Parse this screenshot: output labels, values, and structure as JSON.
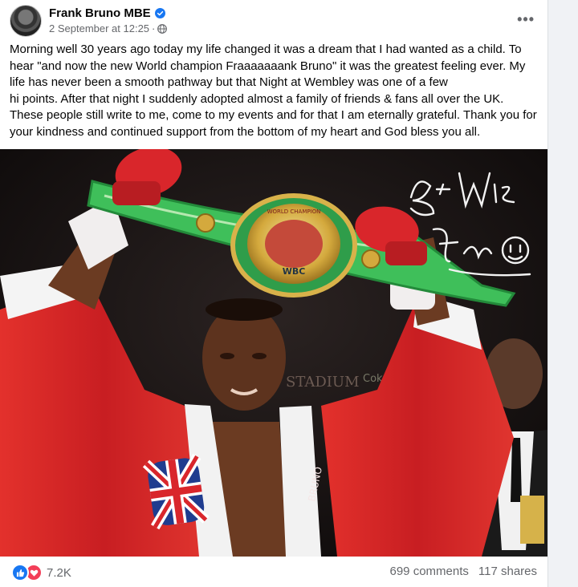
{
  "post": {
    "author": "Frank Bruno MBE",
    "timestamp": "2 September at 12:25",
    "separator": "·",
    "more_menu": "•••",
    "text": "Morning well 30 years ago today my life changed it was a dream that I had wanted as a child. To hear \"and now the new World champion Fraaaaaaank Bruno\" it was the greatest feeling ever. My life has never been a smooth pathway but that Night at Wembley was one of a few\nhi points. After that night I suddenly adopted almost a family of friends & fans all over the UK. These people still write to me, come to my events and for that I am eternally grateful.  Thank you for your kindness and continued support from the bottom of my heart and God bless you all.",
    "photo": {
      "belt_text": "WBC",
      "belt_rim_text": "WORLD CHAMPION",
      "background_sign": "STADIUM",
      "background_sign_2": "Coke",
      "autograph": "Best Wishes Frank Bruno",
      "robe_text": "BRUNO"
    }
  },
  "footer": {
    "reactions_count": "7.2K",
    "comments": "699 comments",
    "shares": "117 shares"
  },
  "colors": {
    "facebook_blue": "#1877f2",
    "love_red": "#f33e58",
    "secondary_text": "#65676b",
    "robe_red": "#d9262b",
    "belt_green": "#3fbf5a"
  },
  "icons": [
    "verified-badge-icon",
    "globe-icon",
    "more-icon",
    "like-reaction-icon",
    "love-reaction-icon"
  ]
}
